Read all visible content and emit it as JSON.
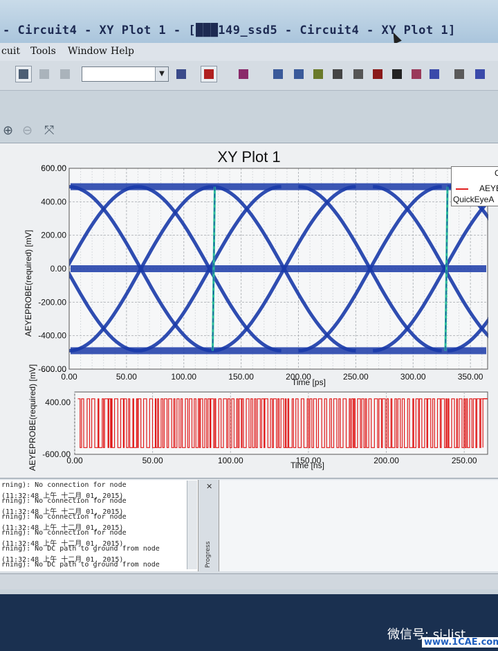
{
  "window": {
    "title": "- Circuit4 - XY Plot 1 - [███149_ssd5 - Circuit4 - XY Plot 1]"
  },
  "menu": [
    "cuit",
    "Tools",
    "Window",
    "Help"
  ],
  "toolbar": {
    "icons": [
      "schematic-icon",
      "component-icon",
      "network-icon",
      "combo-select",
      "probe-icon",
      "quick-icon",
      "marker-icon",
      "split-icon",
      "cross-icon",
      "save-icon",
      "print-icon",
      "document-icon",
      "report-icon",
      "chip-icon",
      "chart-icon",
      "eye-icon",
      "axis-icon",
      "wave-icon"
    ]
  },
  "plot": {
    "title": "XY Plot 1",
    "legend_header": "C",
    "legend_lines": [
      "AEYEP",
      "QuickEyeA"
    ]
  },
  "chart_data": [
    {
      "type": "line",
      "title": "XY Plot 1",
      "xlabel": "Time [ps]",
      "ylabel": "AEYEPROBE(required) [mV]",
      "x_ticks": [
        "0.00",
        "50.00",
        "100.00",
        "150.00",
        "200.00",
        "250.00",
        "300.00",
        "350.00"
      ],
      "y_ticks": [
        "600.00",
        "400.00",
        "200.00",
        "0.00",
        "-200.00",
        "-400.00",
        "-600.00"
      ],
      "xlim": [
        0,
        365
      ],
      "ylim": [
        -600,
        600
      ],
      "grid": true,
      "series": [
        {
          "name": "AEYEP",
          "color": "#1a3aa8"
        }
      ]
    },
    {
      "type": "line",
      "xlabel": "Time [ns]",
      "ylabel": "AEYEPROBE(required) [mV]",
      "x_ticks": [
        "0.00",
        "50.00",
        "100.00",
        "150.00",
        "200.00",
        "250.00"
      ],
      "y_ticks": [
        "400.00",
        "-600.00"
      ],
      "xlim": [
        0,
        265
      ],
      "ylim": [
        -600,
        600
      ],
      "grid": true,
      "series": [
        {
          "name": "AEYEP",
          "color": "#e01818"
        }
      ]
    }
  ],
  "log": {
    "lines": [
      "rning): No connection for node",
      "(11:32:48 上午  十二月 01, 2015)",
      "rning): No connection for node",
      "(11:32:48 上午  十二月 01, 2015)",
      "rning): No connection for node",
      "(11:32:48 上午  十二月 01, 2015)",
      "rning): No connection for node",
      "(11:32:48 上午  十二月 01, 2015)",
      "rning): No DC path to ground from node",
      "(11:32:48 上午  十二月 01, 2015)",
      "rning): No DC path to ground from node"
    ]
  },
  "progress_label": "Progress",
  "watermark": {
    "wechat": "微信号: si-list",
    "site": "www.1CAE.com"
  },
  "colors": {
    "eye": "#1a3aa8",
    "transient": "#e01818",
    "edge": "#2bbf9a"
  }
}
